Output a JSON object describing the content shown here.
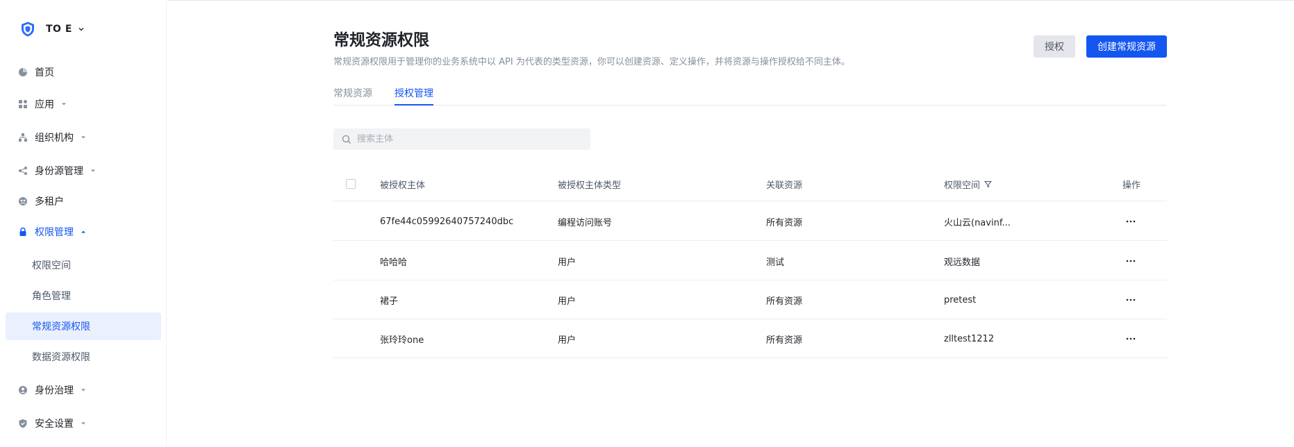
{
  "brand": {
    "name": "TO E"
  },
  "sidebar": {
    "items": [
      {
        "label": "首页"
      },
      {
        "label": "应用"
      },
      {
        "label": "组织机构"
      },
      {
        "label": "身份源管理"
      },
      {
        "label": "多租户"
      },
      {
        "label": "权限管理"
      },
      {
        "label": "身份治理"
      },
      {
        "label": "安全设置"
      }
    ],
    "sub_items": [
      {
        "label": "权限空间"
      },
      {
        "label": "角色管理"
      },
      {
        "label": "常规资源权限"
      },
      {
        "label": "数据资源权限"
      }
    ]
  },
  "header": {
    "title": "常规资源权限",
    "description": "常规资源权限用于管理你的业务系统中以 API 为代表的类型资源，你可以创建资源、定义操作，并将资源与操作授权给不同主体。",
    "grant_label": "授权",
    "create_label": "创建常规资源"
  },
  "tabs": [
    {
      "label": "常规资源"
    },
    {
      "label": "授权管理"
    }
  ],
  "search": {
    "placeholder": "搜索主体"
  },
  "table": {
    "columns": [
      "被授权主体",
      "被授权主体类型",
      "关联资源",
      "权限空间",
      "操作"
    ],
    "rows": [
      {
        "subject": "67fe44c05992640757240dbc",
        "type": "编程访问账号",
        "resource": "所有资源",
        "space": "火山云(navinf..."
      },
      {
        "subject": "哈哈哈",
        "type": "用户",
        "resource": "测试",
        "space": "观远数据"
      },
      {
        "subject": "裙子",
        "type": "用户",
        "resource": "所有资源",
        "space": "pretest"
      },
      {
        "subject": "张玲玲one",
        "type": "用户",
        "resource": "所有资源",
        "space": "zlltest1212"
      }
    ]
  },
  "colors": {
    "accent": "#1456f0",
    "active_bg": "#eaf0fd"
  }
}
